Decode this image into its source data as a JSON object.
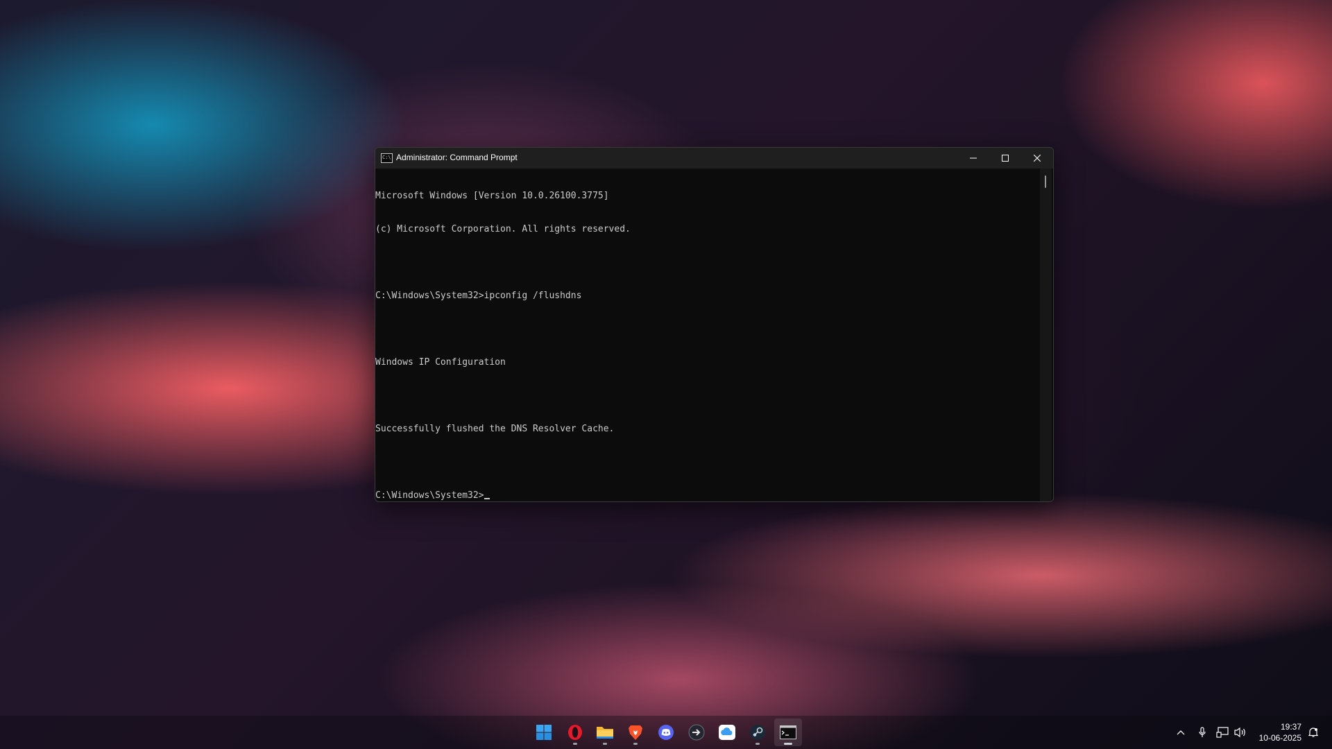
{
  "window": {
    "title": "Administrator: Command Prompt",
    "icon_text": "C:\\",
    "controls": {
      "minimize": "minimize-icon",
      "maximize": "maximize-icon",
      "close": "close-icon"
    }
  },
  "console": {
    "lines": [
      "Microsoft Windows [Version 10.0.26100.3775]",
      "(c) Microsoft Corporation. All rights reserved.",
      "",
      "C:\\Windows\\System32>ipconfig /flushdns",
      "",
      "Windows IP Configuration",
      "",
      "Successfully flushed the DNS Resolver Cache.",
      ""
    ],
    "prompt": "C:\\Windows\\System32>"
  },
  "taskbar": {
    "apps": [
      {
        "name": "windows-start-icon",
        "running": false
      },
      {
        "name": "opera-browser-icon",
        "running": true
      },
      {
        "name": "file-explorer-icon",
        "running": true
      },
      {
        "name": "brave-browser-icon",
        "running": true
      },
      {
        "name": "discord-icon",
        "running": false
      },
      {
        "name": "app-arrow-icon",
        "running": false
      },
      {
        "name": "cloud-icon",
        "running": false
      },
      {
        "name": "steam-icon",
        "running": true
      },
      {
        "name": "command-prompt-icon",
        "running": true,
        "active": true
      }
    ],
    "tray": [
      "chevron-up-icon",
      "microphone-icon",
      "network-icon",
      "speaker-icon",
      "notification-icon"
    ],
    "clock": {
      "time": "19:37",
      "date": "10-06-2025"
    }
  },
  "colors": {
    "console_bg": "#0c0c0c",
    "console_text": "#cccccc",
    "title_bar": "#1f1f1f"
  }
}
